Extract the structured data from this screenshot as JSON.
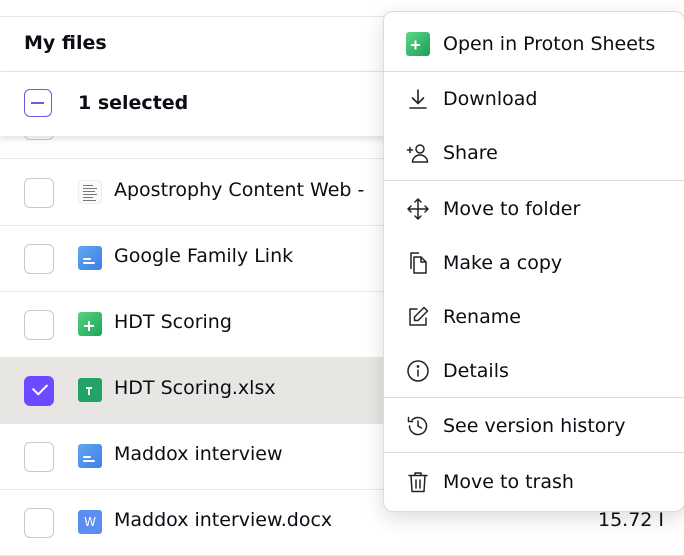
{
  "header": {
    "title": "My files"
  },
  "selection": {
    "label": "1 selected"
  },
  "files": [
    {
      "name": "Apostrophy Content Web -",
      "icon": "document-thumbnail-icon",
      "size": ""
    },
    {
      "name": "Google Family Link",
      "icon": "proton-doc-icon",
      "size": ""
    },
    {
      "name": "HDT Scoring",
      "icon": "proton-sheet-icon",
      "size": ""
    },
    {
      "name": "HDT Scoring.xlsx",
      "icon": "xlsx-file-icon",
      "size": ""
    },
    {
      "name": "Maddox interview",
      "icon": "proton-doc-icon",
      "size": ""
    },
    {
      "name": "Maddox interview.docx",
      "icon": "word-file-icon",
      "size": "15.72 I"
    }
  ],
  "context_menu": {
    "items": [
      {
        "label": "Open in Proton Sheets",
        "icon": "proton-sheets-icon"
      },
      {
        "label": "Download",
        "icon": "download-icon"
      },
      {
        "label": "Share",
        "icon": "share-user-icon"
      },
      {
        "label": "Move to folder",
        "icon": "move-icon"
      },
      {
        "label": "Make a copy",
        "icon": "copy-icon"
      },
      {
        "label": "Rename",
        "icon": "pencil-icon"
      },
      {
        "label": "Details",
        "icon": "info-icon"
      },
      {
        "label": "See version history",
        "icon": "history-icon"
      },
      {
        "label": "Move to trash",
        "icon": "trash-icon"
      }
    ]
  },
  "colors": {
    "accent": "#6d4aff",
    "selected_row": "#e8e6e3",
    "sheet_green": "#1ea65a",
    "doc_blue": "#3d7ee8"
  }
}
